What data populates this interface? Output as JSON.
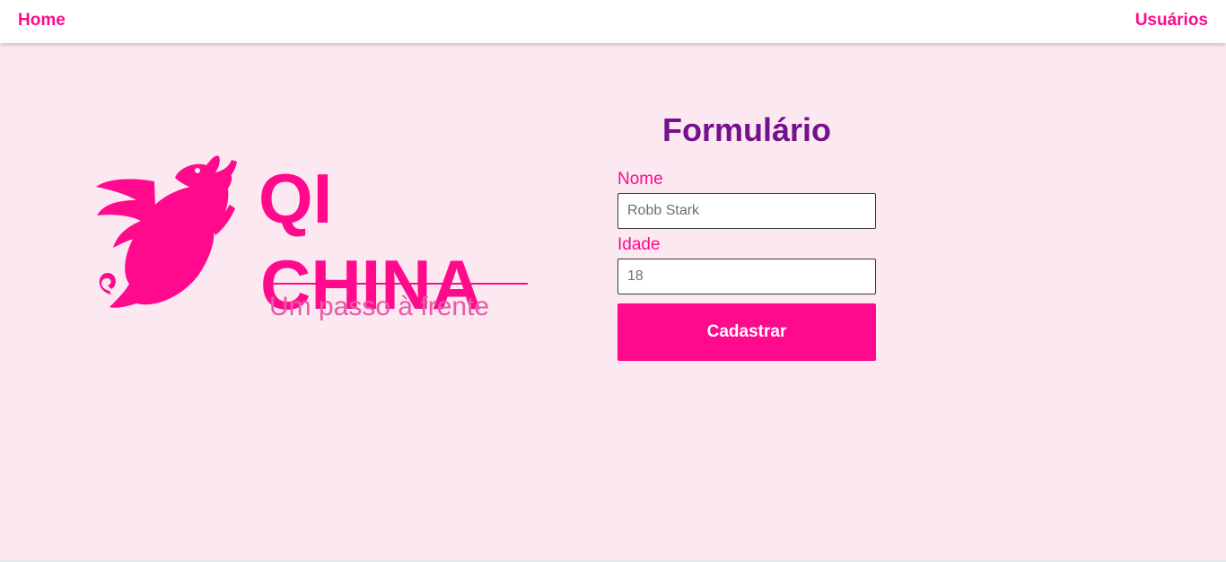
{
  "nav": {
    "home_label": "Home",
    "users_label": "Usuários"
  },
  "logo": {
    "line1": "QI",
    "line2": "CHINA",
    "tagline": "Um passo à frente",
    "icon": "flying-pig-icon"
  },
  "form": {
    "title": "Formulário",
    "name_label": "Nome",
    "name_placeholder": "Robb Stark",
    "age_label": "Idade",
    "age_placeholder": "18",
    "submit_label": "Cadastrar"
  },
  "colors": {
    "accent": "#ff0a8c",
    "title": "#77108c",
    "background": "#fbe8f1",
    "navbar": "#ffffff"
  }
}
